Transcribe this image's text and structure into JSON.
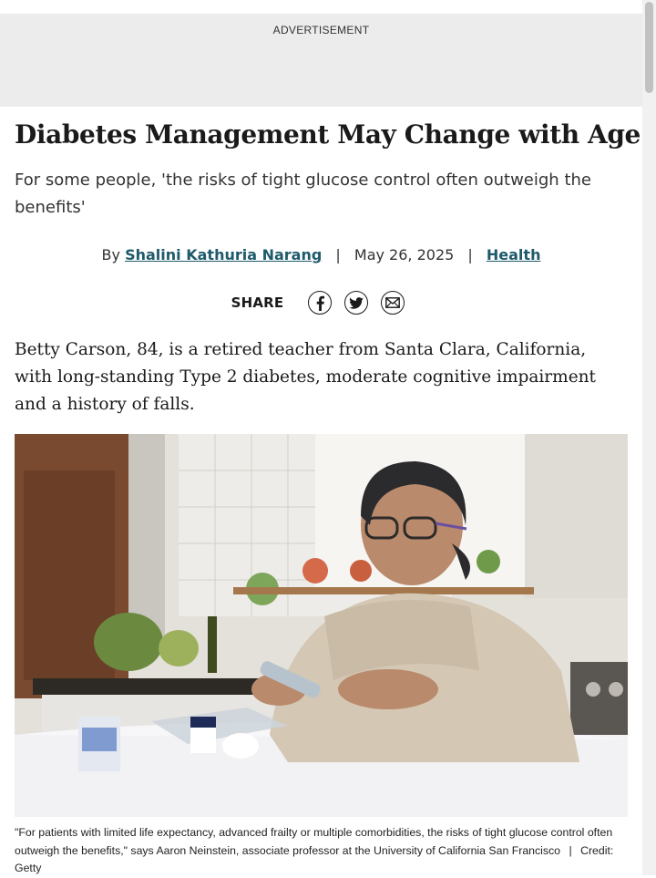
{
  "ad": {
    "label": "ADVERTISEMENT"
  },
  "article": {
    "title": "Diabetes Management May Change with Age",
    "subtitle": "For some people, 'the risks of tight glucose control often outweigh the benefits'",
    "byline": {
      "by": "By",
      "author": "Shalini Kathuria Narang",
      "separator": "|",
      "date": "May 26, 2025",
      "category": "Health"
    },
    "share": {
      "label": "SHARE",
      "icons": [
        "facebook-icon",
        "twitter-icon",
        "email-icon"
      ]
    },
    "lead": "Betty Carson, 84, is a retired teacher from Santa Clara, California, with long-standing Type 2 diabetes, moderate cognitive impairment and a history of falls.",
    "photo": {
      "caption": "\"For patients with limited life expectancy, advanced frailty or multiple comorbidities, the risks of tight glucose control often outweigh the benefits,\" says Aaron Neinstein, associate professor at the University of California San Francisco",
      "separator": "|",
      "credit": "Credit: Getty"
    }
  },
  "colors": {
    "link": "#1f5a6b",
    "ad_background": "#ececec",
    "text": "#1a1a1a"
  }
}
